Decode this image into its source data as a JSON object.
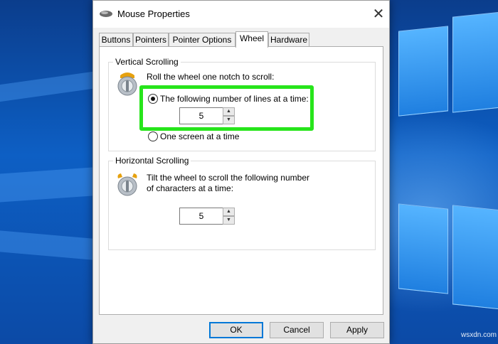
{
  "window": {
    "title": "Mouse Properties",
    "close_glyph": "✕",
    "title_icon": "mouse-icon"
  },
  "tabs": [
    {
      "label": "Buttons",
      "active": false
    },
    {
      "label": "Pointers",
      "active": false
    },
    {
      "label": "Pointer Options",
      "active": false
    },
    {
      "label": "Wheel",
      "active": true
    },
    {
      "label": "Hardware",
      "active": false
    }
  ],
  "vertical_scrolling": {
    "group_title": "Vertical Scrolling",
    "description": "Roll the wheel one notch to scroll:",
    "option_lines_label": "The following number of lines at a time:",
    "option_lines_checked": true,
    "lines_value": "5",
    "option_screen_label": "One screen at a time",
    "option_screen_checked": false,
    "highlight_color": "#27e51b"
  },
  "horizontal_scrolling": {
    "group_title": "Horizontal Scrolling",
    "description_line1": "Tilt the wheel to scroll the following number",
    "description_line2": "of characters at a time:",
    "chars_value": "5"
  },
  "buttons": {
    "ok": "OK",
    "cancel": "Cancel",
    "apply": "Apply"
  },
  "spinner_glyphs": {
    "up": "▲",
    "down": "▼"
  },
  "watermark": "wsxdn.com",
  "colors": {
    "accent": "#0078d7",
    "desktop": "#0d5fc4"
  }
}
